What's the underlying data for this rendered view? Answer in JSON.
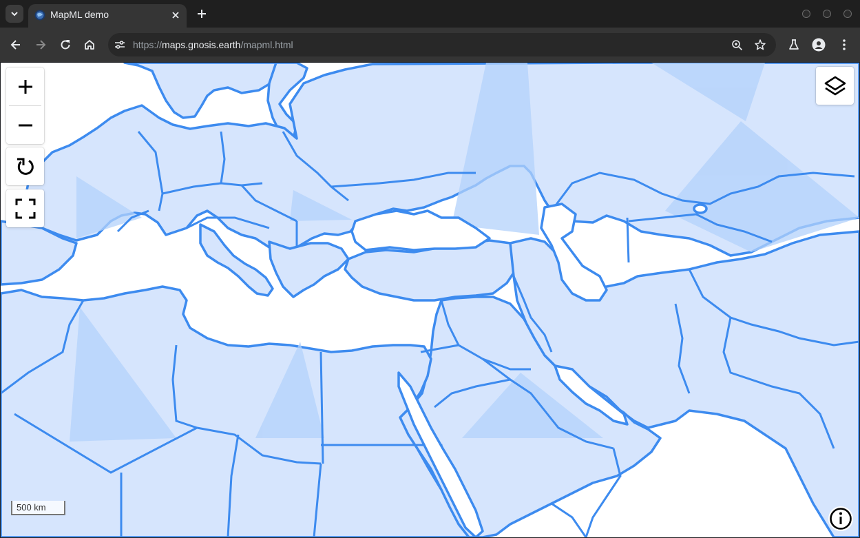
{
  "browser": {
    "tab_title": "MapML demo",
    "url_scheme": "https://",
    "url_host": "maps.gnosis.earth",
    "url_path": "/mapml.html"
  },
  "map": {
    "scale_label": "500 km",
    "land_color": "#d6e5fd",
    "border_color": "#3d8bef",
    "water_color": "#ffffff",
    "shade_color": "#b3d1fb",
    "controls": [
      "zoom-in-icon",
      "zoom-out-icon",
      "reload-icon",
      "fullscreen-icon",
      "layers-icon",
      "info-icon"
    ]
  }
}
